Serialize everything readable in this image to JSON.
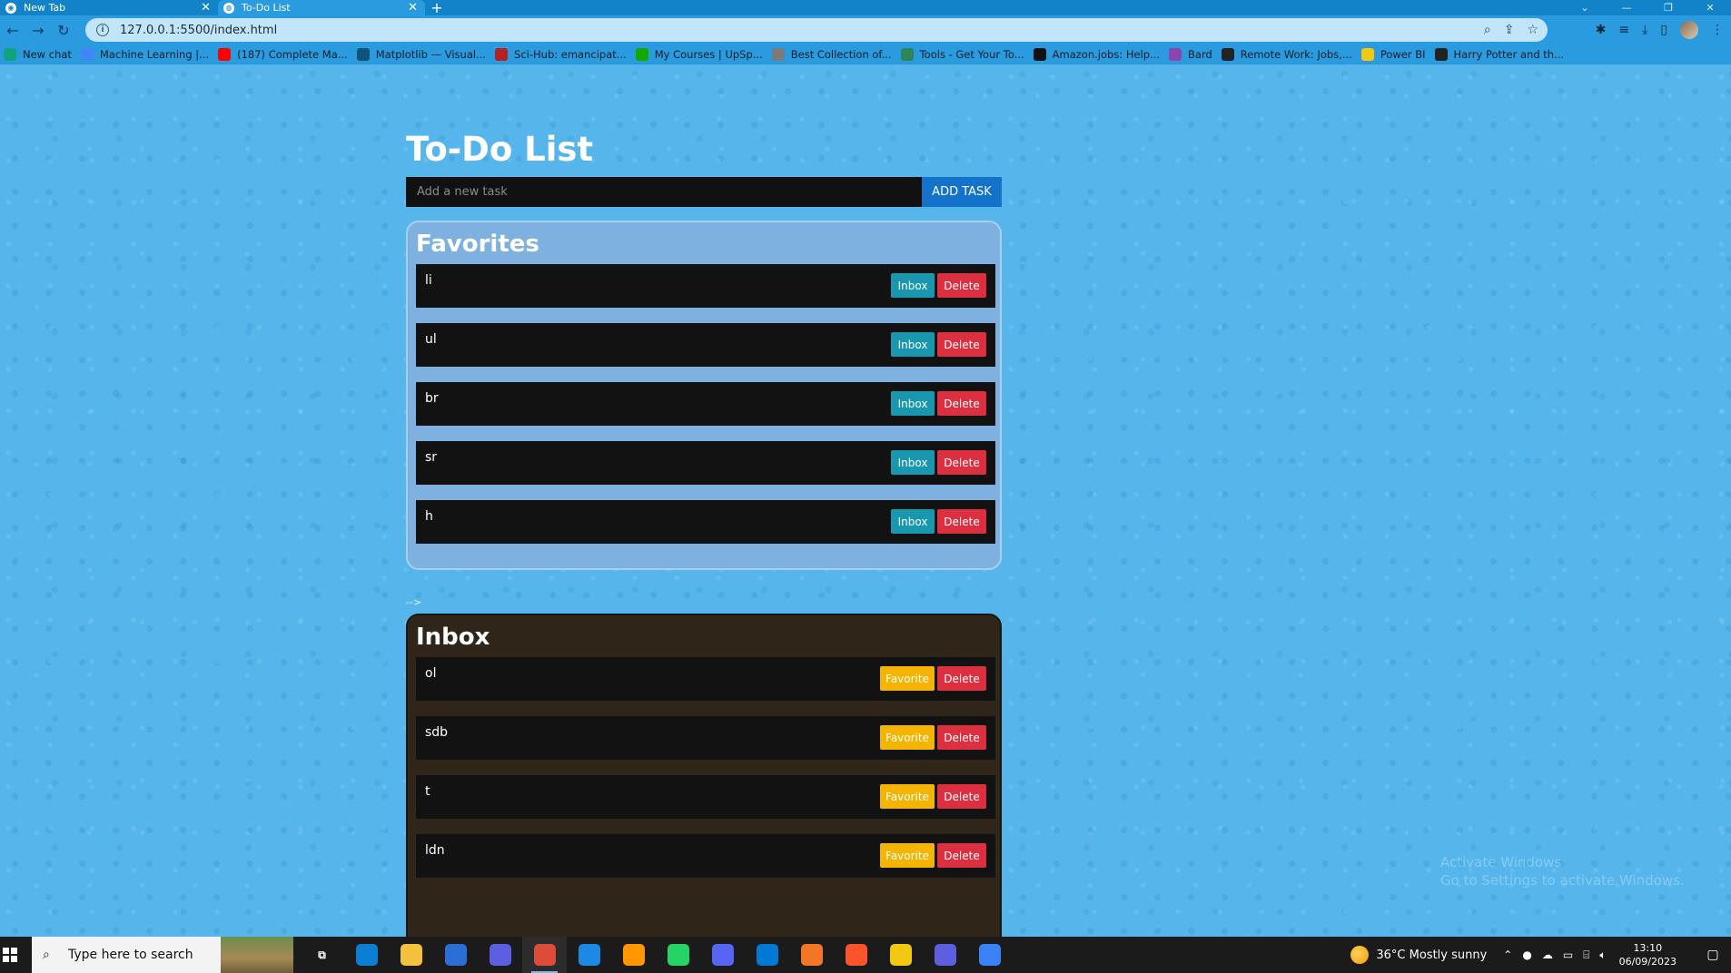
{
  "browser": {
    "tabs": [
      {
        "title": "New Tab",
        "active": false
      },
      {
        "title": "To-Do List",
        "active": true
      }
    ],
    "new_tab_symbol": "+",
    "url": "127.0.0.1:5500/index.html",
    "bookmarks": [
      {
        "label": "New chat",
        "icon": "openai-icon",
        "color": "#10a37f"
      },
      {
        "label": "Machine Learning |...",
        "icon": "google-icon",
        "color": "#4285f4"
      },
      {
        "label": "(187) Complete Ma...",
        "icon": "youtube-icon",
        "color": "#ff0000"
      },
      {
        "label": "Matplotlib — Visual...",
        "icon": "matplotlib-icon",
        "color": "#11557c"
      },
      {
        "label": "Sci-Hub: emancipat...",
        "icon": "scihub-icon",
        "color": "#b22222"
      },
      {
        "label": "My Courses | UpSp...",
        "icon": "upwork-icon",
        "color": "#14a800"
      },
      {
        "label": "Best Collection of...",
        "icon": "collection-icon",
        "color": "#7a7a7a"
      },
      {
        "label": "Tools - Get Your To...",
        "icon": "tools-icon",
        "color": "#2f855a"
      },
      {
        "label": "Amazon.jobs: Help...",
        "icon": "amazon-icon",
        "color": "#111111"
      },
      {
        "label": "Bard",
        "icon": "bard-icon",
        "color": "#8e44ad"
      },
      {
        "label": "Remote Work: Jobs,...",
        "icon": "remote-icon",
        "color": "#222222"
      },
      {
        "label": "Power BI",
        "icon": "powerbi-icon",
        "color": "#f2c811"
      },
      {
        "label": "Harry Potter and th...",
        "icon": "book-icon",
        "color": "#222222"
      }
    ]
  },
  "app": {
    "title": "To-Do List",
    "input_placeholder": "Add a new task",
    "add_button": "ADD TASK",
    "stray_text": "-->",
    "favorites": {
      "heading": "Favorites",
      "move_label": "Inbox",
      "delete_label": "Delete",
      "tasks": [
        "li",
        "ul",
        "br",
        "sr",
        "h"
      ]
    },
    "inbox": {
      "heading": "Inbox",
      "move_label": "Favorite",
      "delete_label": "Delete",
      "tasks": [
        "ol",
        "sdb",
        "t",
        "ldn"
      ]
    }
  },
  "watermark": {
    "line1": "Activate Windows",
    "line2": "Go to Settings to activate Windows."
  },
  "colors": {
    "page_bg": "#56b6ec",
    "favorites_panel": "#7eb1e0",
    "inbox_panel": "#2f2519",
    "row_bg": "#121212",
    "add_button": "#1372c9",
    "inbox_button": "#1897ae",
    "favorite_button": "#f5b400",
    "delete_button": "#dc3040"
  },
  "taskbar": {
    "search_placeholder": "Type here to search",
    "apps": [
      "task-view-icon",
      "edge-icon",
      "file-explorer-icon",
      "microsoft-store-icon",
      "app-icon",
      "chrome-icon",
      "mail-icon",
      "sublime-icon",
      "whatsapp-icon",
      "discord-icon",
      "vscode-icon",
      "jupyter-icon",
      "brave-icon",
      "power-bi-icon",
      "app-icon-2",
      "qbittorrent-icon"
    ],
    "weather": "36°C  Mostly sunny",
    "time": "13:10",
    "date": "06/09/2023"
  }
}
